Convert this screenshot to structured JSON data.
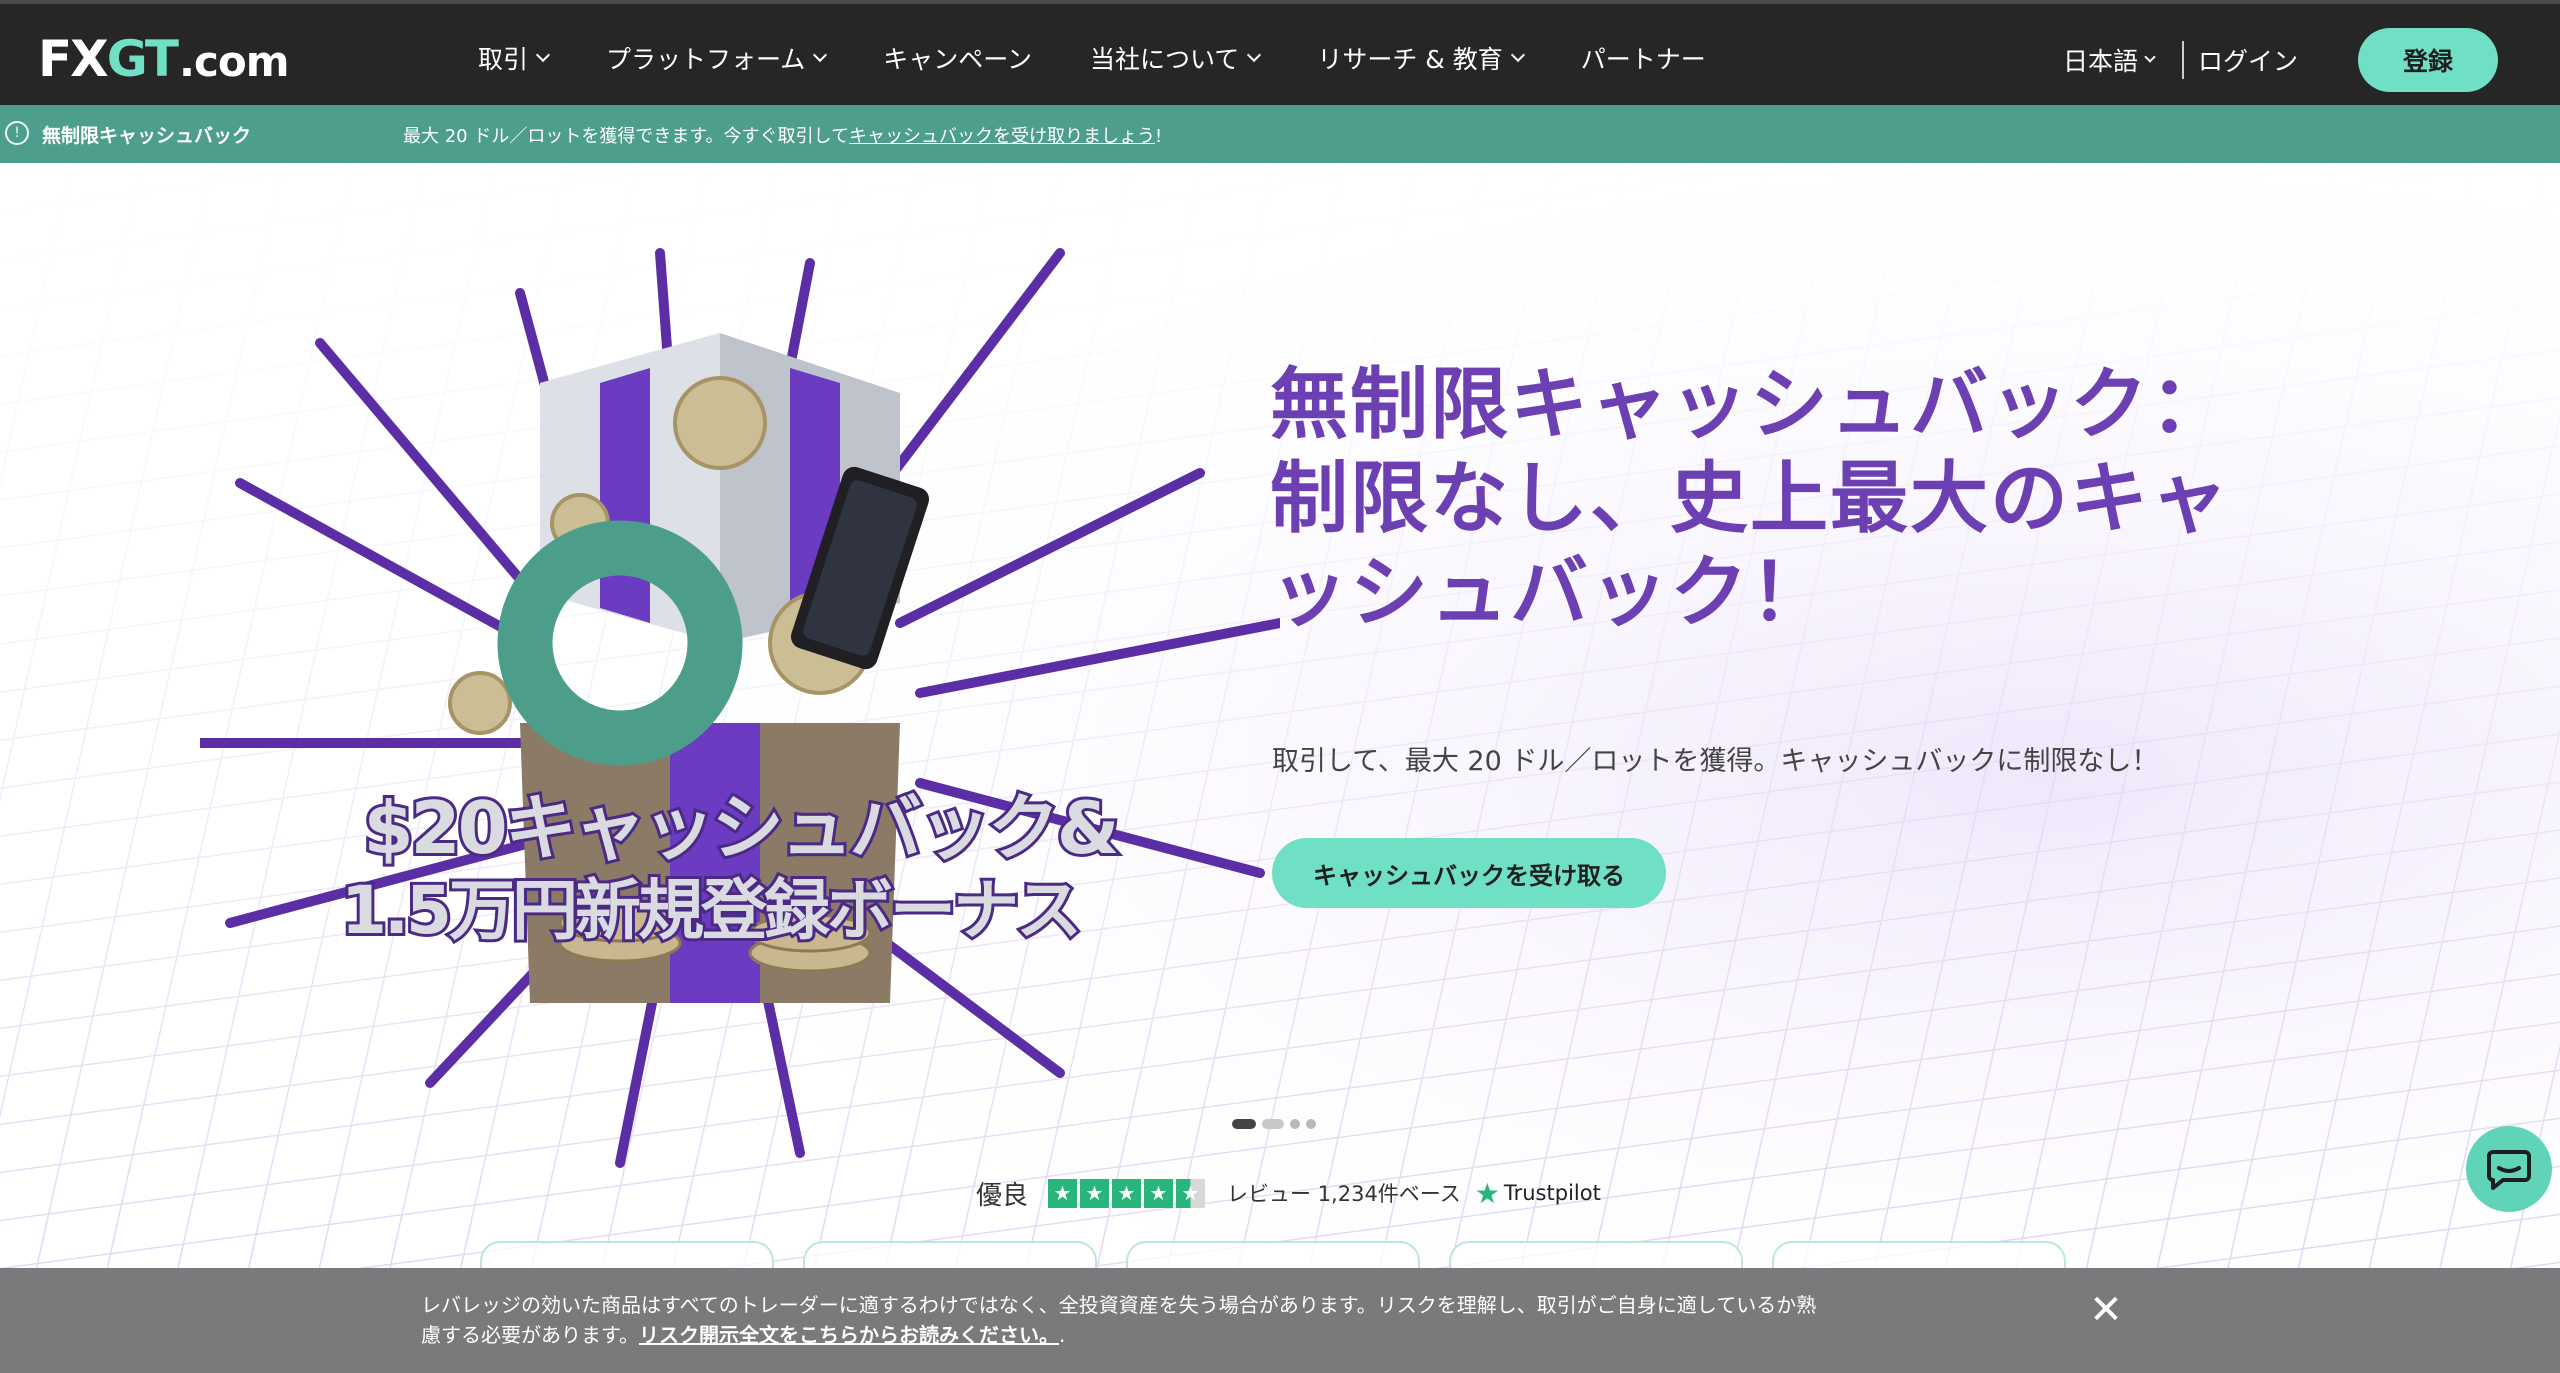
{
  "header": {
    "logo_fx": "FX",
    "logo_gt": "GT",
    "logo_com": ".com",
    "nav": [
      {
        "label": "取引",
        "has_dropdown": true
      },
      {
        "label": "プラットフォーム",
        "has_dropdown": true
      },
      {
        "label": "キャンペーン",
        "has_dropdown": false
      },
      {
        "label": "当社について",
        "has_dropdown": true
      },
      {
        "label": "リサーチ & 教育",
        "has_dropdown": true
      },
      {
        "label": "パートナー",
        "has_dropdown": false
      }
    ],
    "language": "日本語",
    "login": "ログイン",
    "register": "登録"
  },
  "promo": {
    "title": "無制限キャッシュバック",
    "message_prefix": "最大 20 ドル／ロットを獲得できます。今すぐ取引して",
    "message_link": "キャッシュバックを受け取りましょう",
    "message_suffix": "!"
  },
  "hero": {
    "art_line1": "$20キャッシュバック&",
    "art_line2": "1.5万円新規登録ボーナス",
    "headline_line1": "無制限キャッシュバック：",
    "headline_line2": "制限なし、史上最大のキャ",
    "headline_line3": "ッシュバック！",
    "subtext": "取引して、最大 20 ドル／ロットを獲得。キャッシュバックに制限なし！",
    "cta": "キャッシュバックを受け取る",
    "carousel": {
      "active_index": 0,
      "count": 4
    }
  },
  "trustpilot": {
    "rating_label": "優良",
    "stars": 4.5,
    "reviews": "レビュー 1,234件ベース",
    "brand": "Trustpilot"
  },
  "risk_warning": {
    "line1": "レバレッジの効いた商品はすべてのトレーダーに適するわけではなく、全投資資産を失う場合があります。リスクを理解し、取引がご自身に適しているか熟",
    "line2_prefix": "慮する必要があります。",
    "line2_link": "リスク開示全文をこちらからお読みください。",
    "line2_suffix": "."
  },
  "colors": {
    "accent": "#6fe0c5",
    "purple": "#6c3fb3",
    "promo_bar": "#4d9e8c",
    "nav_bg": "#262626"
  }
}
